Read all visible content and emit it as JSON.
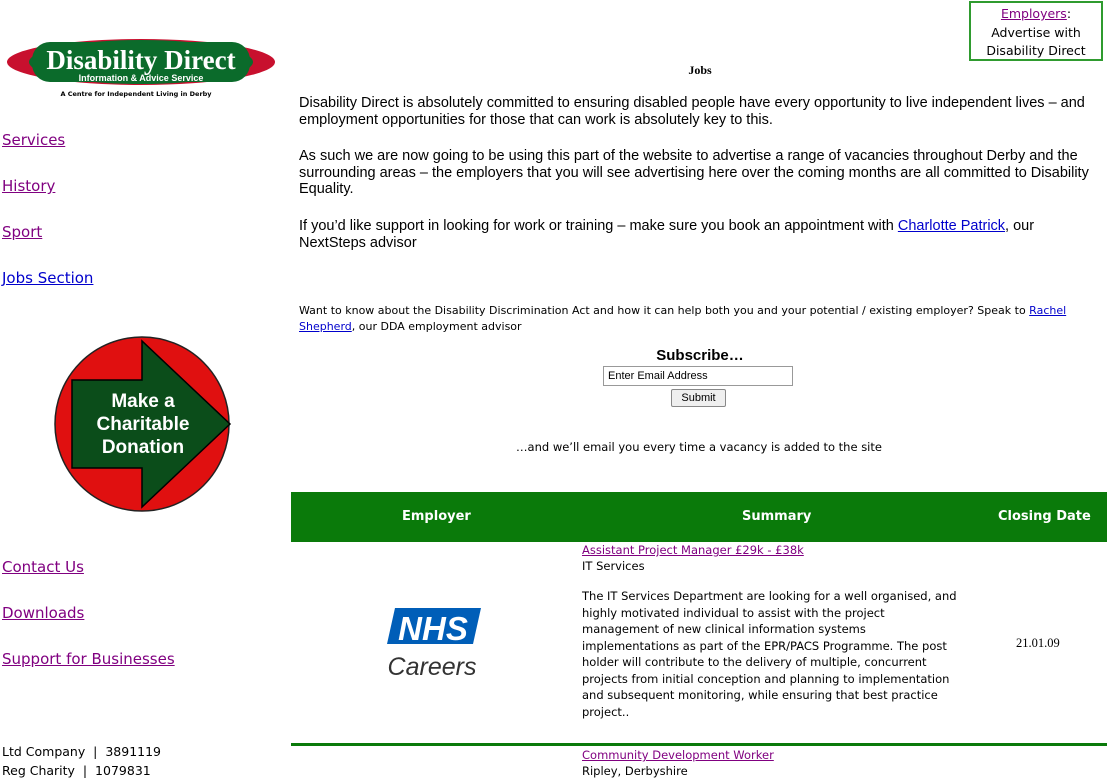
{
  "logo": {
    "title": "Disability Direct",
    "subtitle": "Information & Advice Service",
    "tagline": "A Centre for Independent Living in Derby"
  },
  "nav_top": [
    "Services",
    "History",
    "Sport",
    "Jobs Section"
  ],
  "donate": {
    "line1": "Make a",
    "line2": "Charitable",
    "line3": "Donation"
  },
  "nav_bottom": [
    "Contact Us",
    "Downloads",
    "Support for Businesses"
  ],
  "registration": {
    "line1": "Ltd Company  |  3891119",
    "line2": "Reg Charity  |  1079831"
  },
  "employers_box": {
    "link": "Employers",
    "colon": ":",
    "line2": "Advertise with",
    "line3": "Disability Direct"
  },
  "main": {
    "title": "Jobs",
    "para1": "Disability Direct is absolutely committed to ensuring disabled people have every opportunity to live independent lives – and employment opportunities for those that can work is absolutely key to this.",
    "para2": "As such we are now going to be using this part of the website to advertise a range of vacancies throughout Derby and the surrounding areas – the employers that you will see advertising here over the coming months are all committed to Disability Equality.",
    "para3_pre": "If you’d like support in looking for work or training – make sure you book an appointment with ",
    "para3_link": "Charlotte Patrick",
    "para3_post": ", our NextSteps advisor",
    "dda_pre": "Want to know about the Disability Discrimination Act and how it can help both you and your potential / existing employer? Speak to ",
    "dda_link": "Rachel Shepherd",
    "dda_post": ", our DDA employment advisor"
  },
  "subscribe": {
    "title": "Subscribe…",
    "input_value": "Enter Email Address",
    "button": "Submit",
    "note": "…and we’ll email you every time a vacancy is added to the site"
  },
  "table": {
    "headers": {
      "employer": "Employer",
      "summary": "Summary",
      "closing": "Closing Date"
    },
    "rows": [
      {
        "employer_logo": {
          "top": "NHS",
          "bottom": "Careers"
        },
        "title": "Assistant Project Manager £29k - £38k",
        "location": "IT Services",
        "description": "The IT Services Department are looking for a well organised, and highly motivated individual to assist with the project management of new clinical information systems implementations as part of the EPR/PACS Programme. The post holder will contribute to the delivery of multiple, concurrent projects from initial conception and planning to implementation and subsequent monitoring, while ensuring that best practice project..",
        "closing": "21.01.09"
      },
      {
        "title": "Community Development Worker",
        "location": "Ripley, Derbyshire"
      }
    ]
  },
  "colors": {
    "header_green": "#0a7a0a",
    "link_blue": "#0000cc",
    "visited_purple": "#800080",
    "donate_red": "#e01010"
  }
}
